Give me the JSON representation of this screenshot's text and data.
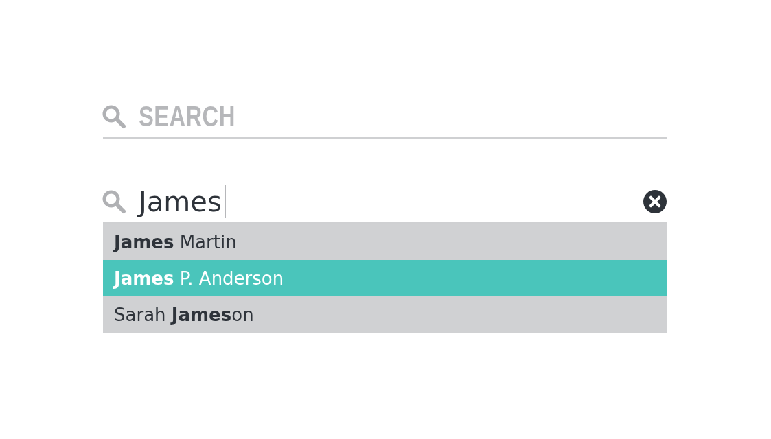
{
  "search_fields": [
    {
      "placeholder": "SEARCH"
    },
    {
      "value": "James",
      "focused": true,
      "clear_button": true,
      "suggestions": [
        {
          "text": "**James** Martin",
          "selected": false
        },
        {
          "text": "**James** P. Anderson",
          "selected": true
        },
        {
          "text": "Sarah **James**on",
          "selected": false
        }
      ]
    }
  ]
}
